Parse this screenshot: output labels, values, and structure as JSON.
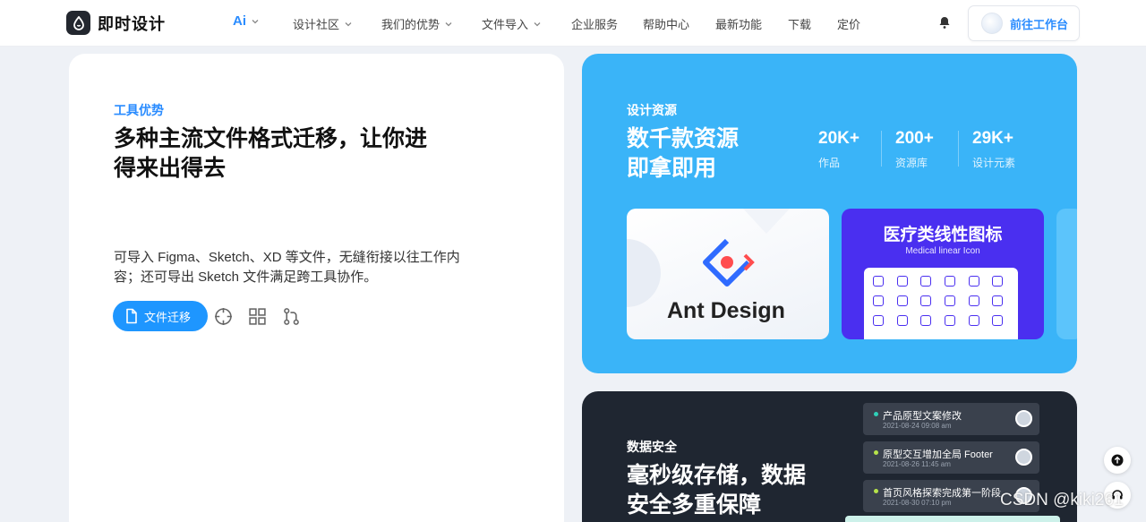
{
  "nav": {
    "brand": "即时设计",
    "menu": [
      {
        "label": "Ai",
        "has_dropdown": true
      },
      {
        "label": "设计社区",
        "has_dropdown": true
      },
      {
        "label": "我们的优势",
        "has_dropdown": true
      },
      {
        "label": "文件导入",
        "has_dropdown": true
      },
      {
        "label": "企业服务",
        "has_dropdown": false
      },
      {
        "label": "帮助中心",
        "has_dropdown": false
      },
      {
        "label": "最新功能",
        "has_dropdown": false
      },
      {
        "label": "下载",
        "has_dropdown": false
      },
      {
        "label": "定价",
        "has_dropdown": false
      }
    ],
    "cta_label": "前往工作台"
  },
  "left_card": {
    "eyebrow": "工具优势",
    "headline_line1": "多种主流文件格式迁移，让你进",
    "headline_line2": "得来出得去",
    "desc_line1": "可导入 Figma、Sketch、XD 等文件，无缝衔接以往工作内",
    "desc_line2": "容；还可导出 Sketch 文件满足跨工具协作。",
    "active_tool": "文件迁移"
  },
  "resource_card": {
    "eyebrow": "设计资源",
    "headline_line1": "数千款资源",
    "headline_line2": "即拿即用",
    "stats": [
      {
        "value": "20K+",
        "label": "作品"
      },
      {
        "value": "200+",
        "label": "资源库"
      },
      {
        "value": "29K+",
        "label": "设计元素"
      }
    ],
    "thumb_ant": "Ant Design",
    "thumb_med_title": "医疗类线性图标",
    "thumb_med_sub": "Medical linear Icon"
  },
  "security_card": {
    "eyebrow": "数据安全",
    "headline_line1": "毫秒级存储，数据",
    "headline_line2": "安全多重保障",
    "tasks": [
      {
        "title": "产品原型文案修改",
        "time": "2021-08-24 09:08 am",
        "dot_color": "#2fd0b8"
      },
      {
        "title": "原型交互增加全局 Footer",
        "time": "2021-08-26 11:45 am",
        "dot_color": "#b6e34a"
      },
      {
        "title": "首页风格探索完成第一阶段",
        "time": "2021-08-30 07:10 pm",
        "dot_color": "#b6e34a"
      }
    ]
  },
  "watermark": "CSDN @kiki261",
  "colors": {
    "accent": "#1e96ff",
    "resource_bg": "#3ab4f8",
    "security_bg": "#1f2631"
  }
}
